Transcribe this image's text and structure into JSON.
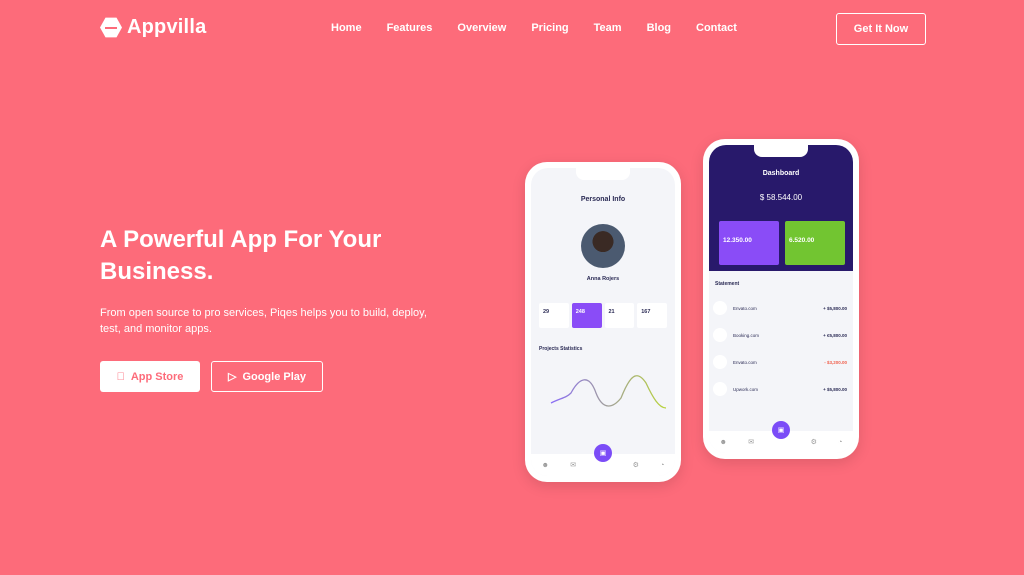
{
  "brand": {
    "name": "Appvilla"
  },
  "nav": {
    "items": [
      "Home",
      "Features",
      "Overview",
      "Pricing",
      "Team",
      "Blog",
      "Contact"
    ],
    "cta": "Get It Now"
  },
  "hero": {
    "title": "A Powerful App For Your Business.",
    "subtitle": "From open source to pro services, Piqes helps you to build, deploy, test, and monitor apps.",
    "app_store": "App Store",
    "google_play": "Google Play"
  },
  "phone1": {
    "title": "Personal Info",
    "name": "Anna Rojers",
    "stats": [
      "29",
      "248",
      "21",
      "167"
    ],
    "section": "Projects Statistics"
  },
  "phone2": {
    "title": "Dashboard",
    "balance": "$ 58.544.00",
    "card1": "12.350.00",
    "card2": "6.520.00",
    "section": "Statement",
    "rows": [
      {
        "name": "Envato.com",
        "amount": "+ $5,800.00"
      },
      {
        "name": "Booking.com",
        "amount": "+ €5,800.00"
      },
      {
        "name": "Envato.com",
        "amount": "- $3,200.00"
      },
      {
        "name": "Upwork.com",
        "amount": "+ $5,800.00"
      }
    ]
  },
  "colors": {
    "background": "#fd6b7a",
    "accent": "#8a4cf7",
    "dashboard": "#28196b",
    "green": "#72c531",
    "negative": "#f0604d"
  }
}
